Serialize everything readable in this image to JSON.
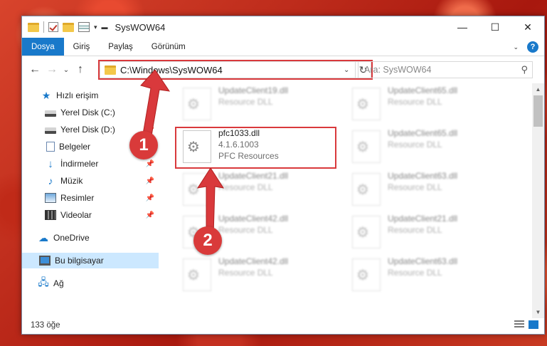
{
  "window": {
    "title": "SysWOW64",
    "controls": {
      "minimize": "—",
      "maximize": "☐",
      "close": "✕"
    }
  },
  "ribbon": {
    "tabs": [
      {
        "label": "Dosya",
        "active": true
      },
      {
        "label": "Giriş"
      },
      {
        "label": "Paylaş"
      },
      {
        "label": "Görünüm"
      }
    ],
    "help": "?"
  },
  "address": {
    "path": "C:\\Windows\\SysWOW64",
    "search_placeholder": "Ara: SysWOW64"
  },
  "nav": {
    "items": [
      {
        "label": "Hızlı erişim",
        "icon": "star-icon"
      },
      {
        "label": "Yerel Disk (C:)",
        "icon": "drive-icon",
        "pinned": true
      },
      {
        "label": "Yerel Disk (D:)",
        "icon": "drive-icon",
        "pinned": true
      },
      {
        "label": "Belgeler",
        "icon": "document-icon",
        "pinned": true
      },
      {
        "label": "İndirmeler",
        "icon": "download-icon",
        "pinned": true
      },
      {
        "label": "Müzik",
        "icon": "music-icon",
        "pinned": true
      },
      {
        "label": "Resimler",
        "icon": "pictures-icon",
        "pinned": true
      },
      {
        "label": "Videolar",
        "icon": "videos-icon",
        "pinned": true
      },
      {
        "label": "OneDrive",
        "icon": "cloud-icon"
      },
      {
        "label": "Bu bilgisayar",
        "icon": "computer-icon",
        "selected": true
      },
      {
        "label": "Ağ",
        "icon": "network-icon"
      }
    ]
  },
  "files": [
    {
      "name": "UpdateClient19.dll",
      "detail": "Resource DLL",
      "col": 0,
      "row": 0,
      "blurred": true
    },
    {
      "name": "pfc1033.dll",
      "version": "4.1.6.1003",
      "detail": "PFC Resources",
      "col": 0,
      "row": 1,
      "blurred": false
    },
    {
      "name": "UpdateClient21.dll",
      "detail": "Resource DLL",
      "col": 0,
      "row": 2,
      "blurred": true
    },
    {
      "name": "UpdateClient42.dll",
      "detail": "Resource DLL",
      "col": 0,
      "row": 3,
      "blurred": true
    },
    {
      "name": "UpdateClient42.dll",
      "detail": "Resource DLL",
      "col": 0,
      "row": 4,
      "blurred": true
    },
    {
      "name": "UpdateClient65.dll",
      "detail": "Resource DLL",
      "col": 1,
      "row": 0,
      "blurred": true
    },
    {
      "name": "UpdateClient65.dll",
      "detail": "Resource DLL",
      "col": 1,
      "row": 1,
      "blurred": true
    },
    {
      "name": "UpdateClient63.dll",
      "detail": "Resource DLL",
      "col": 1,
      "row": 2,
      "blurred": true
    },
    {
      "name": "UpdateClient21.dll",
      "detail": "Resource DLL",
      "col": 1,
      "row": 3,
      "blurred": true
    },
    {
      "name": "UpdateClient63.dll",
      "detail": "Resource DLL",
      "col": 1,
      "row": 4,
      "blurred": true
    }
  ],
  "status": {
    "item_count": "133 öğe"
  },
  "annotations": {
    "step1": "1",
    "step2": "2",
    "accent": "#d9393c"
  }
}
